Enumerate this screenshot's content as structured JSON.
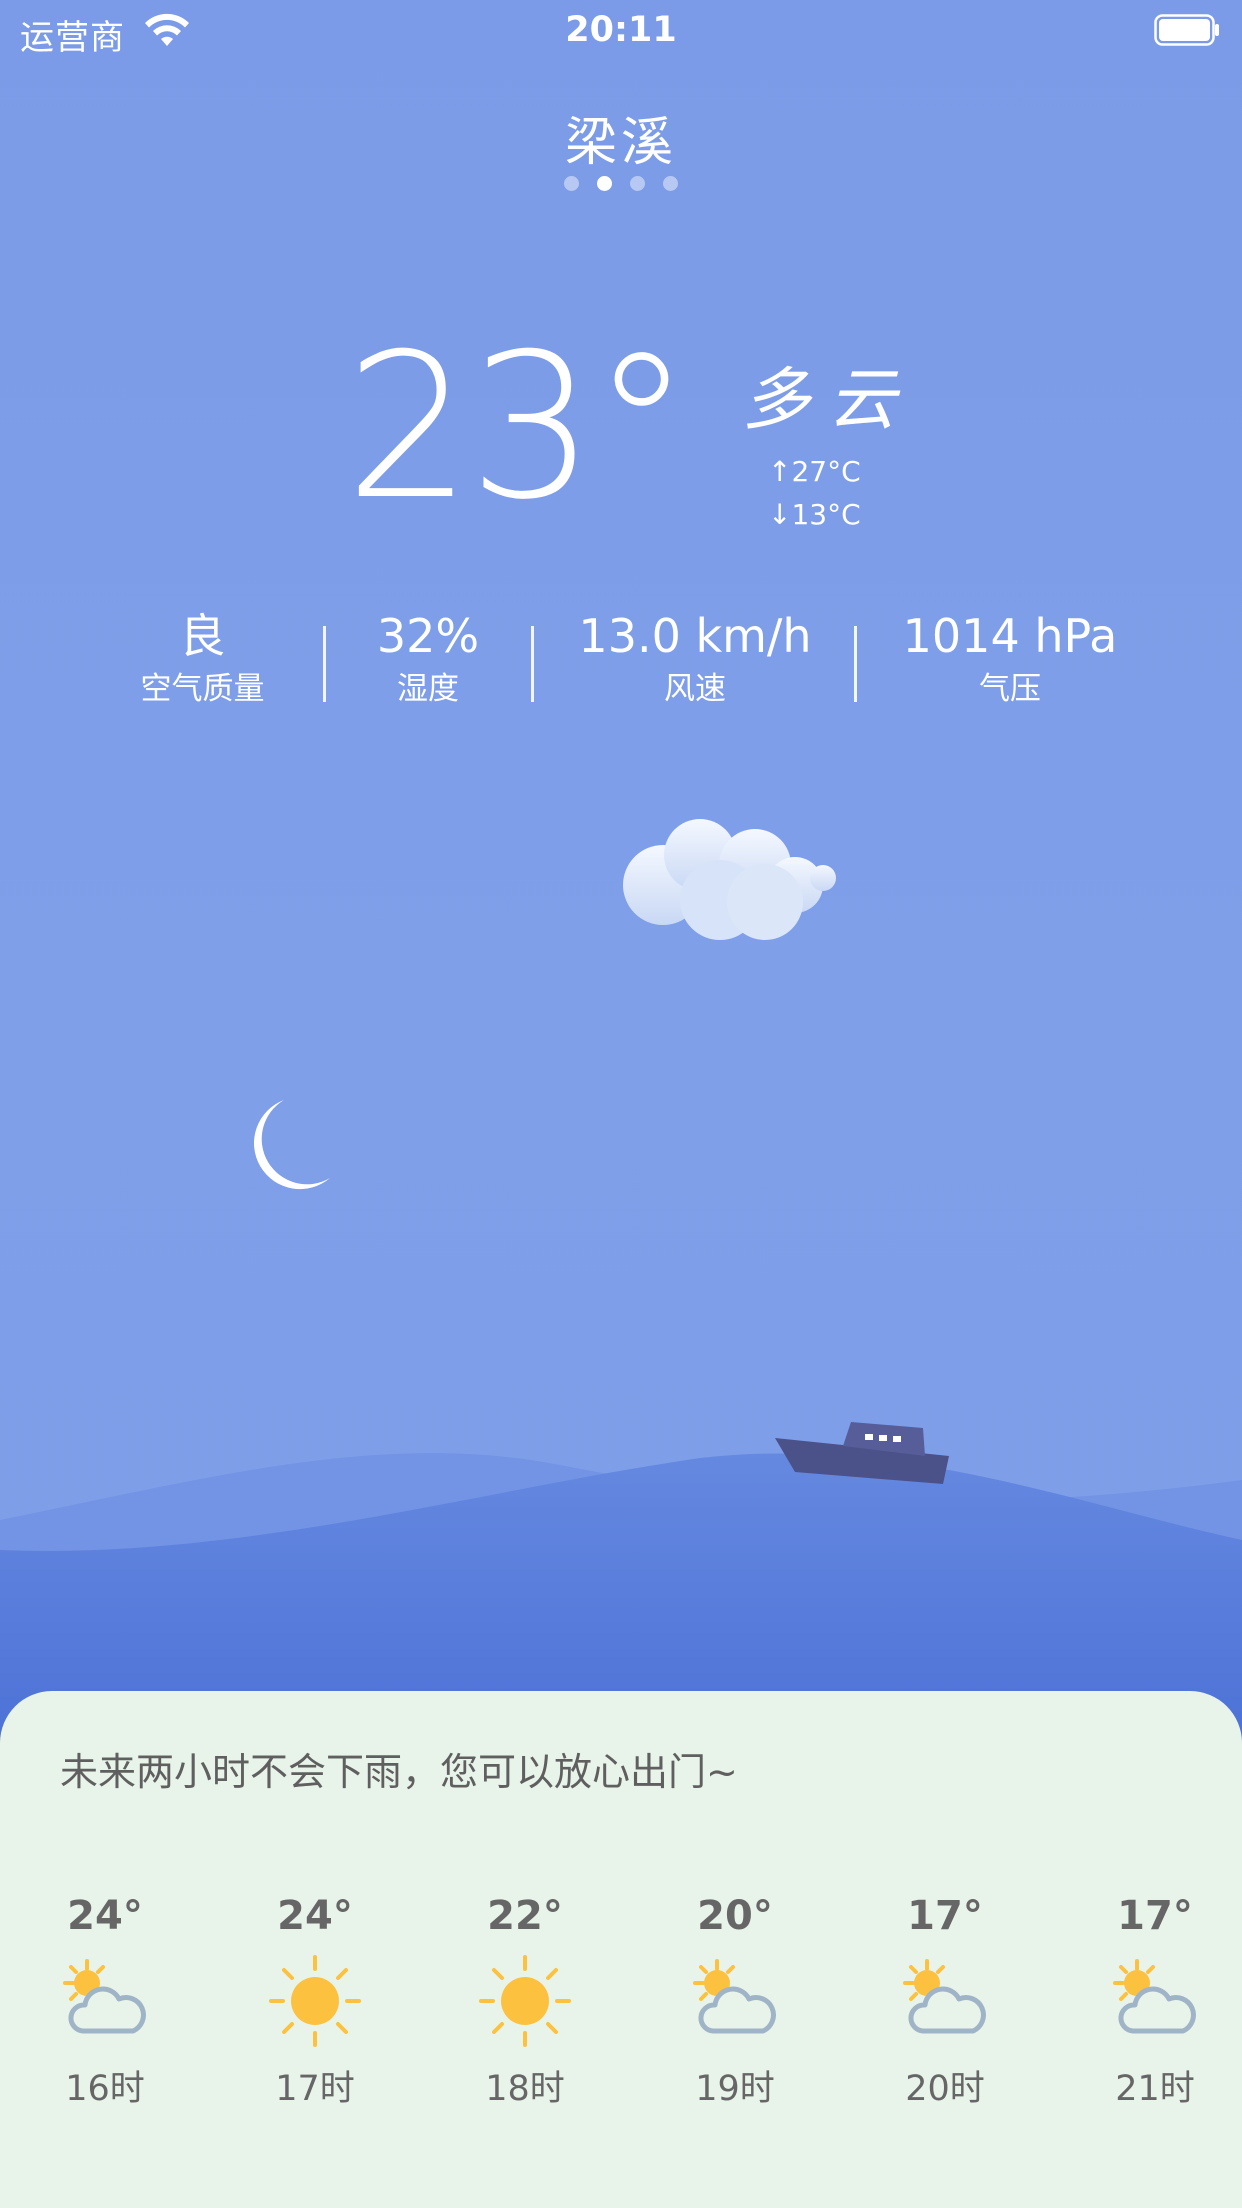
{
  "status_bar": {
    "carrier": "运营商",
    "time": "20:11"
  },
  "header": {
    "city": "梁溪",
    "page_count": 4,
    "active_page": 2
  },
  "current": {
    "temperature": "23°",
    "condition": "多云",
    "high": "↑27°C",
    "low": "↓13°C"
  },
  "stats": [
    {
      "value": "良",
      "label": "空气质量"
    },
    {
      "value": "32%",
      "label": "湿度"
    },
    {
      "value": "13.0 km/h",
      "label": "风速"
    },
    {
      "value": "1014 hPa",
      "label": "气压"
    }
  ],
  "forecast_panel": {
    "notice": "未来两小时不会下雨，您可以放心出门~",
    "hours": [
      {
        "temp": "24°",
        "icon": "partly-cloudy-icon",
        "hour": "16时"
      },
      {
        "temp": "24°",
        "icon": "sunny-icon",
        "hour": "17时"
      },
      {
        "temp": "22°",
        "icon": "sunny-icon",
        "hour": "18时"
      },
      {
        "temp": "20°",
        "icon": "partly-cloudy-icon",
        "hour": "19时"
      },
      {
        "temp": "17°",
        "icon": "partly-cloudy-icon",
        "hour": "20时"
      },
      {
        "temp": "17°",
        "icon": "partly-cloudy-icon",
        "hour": "21时"
      }
    ]
  },
  "colors": {
    "sky": "#7b9be8",
    "sea_dark": "#4a6fd6",
    "panel_bg": "#e8f4ea",
    "sun": "#fcc23f",
    "cloud_outline": "#9fb4c7"
  }
}
